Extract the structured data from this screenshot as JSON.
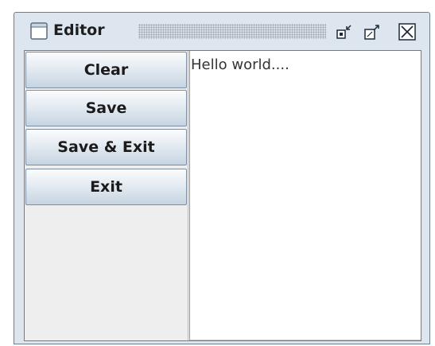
{
  "window": {
    "title": "Editor",
    "icon": "window-icon",
    "controls": [
      "minimize-icon",
      "maximize-icon",
      "close-icon"
    ]
  },
  "buttons": {
    "clear": "Clear",
    "save": "Save",
    "save_exit": "Save & Exit",
    "exit": "Exit"
  },
  "editor": {
    "text": "Hello world...."
  },
  "colors": {
    "frame": "#dde6ee",
    "button_gradient_top": "#fbfcfd",
    "button_gradient_bottom": "#c6d4e1",
    "text_area": "#ffffff"
  }
}
